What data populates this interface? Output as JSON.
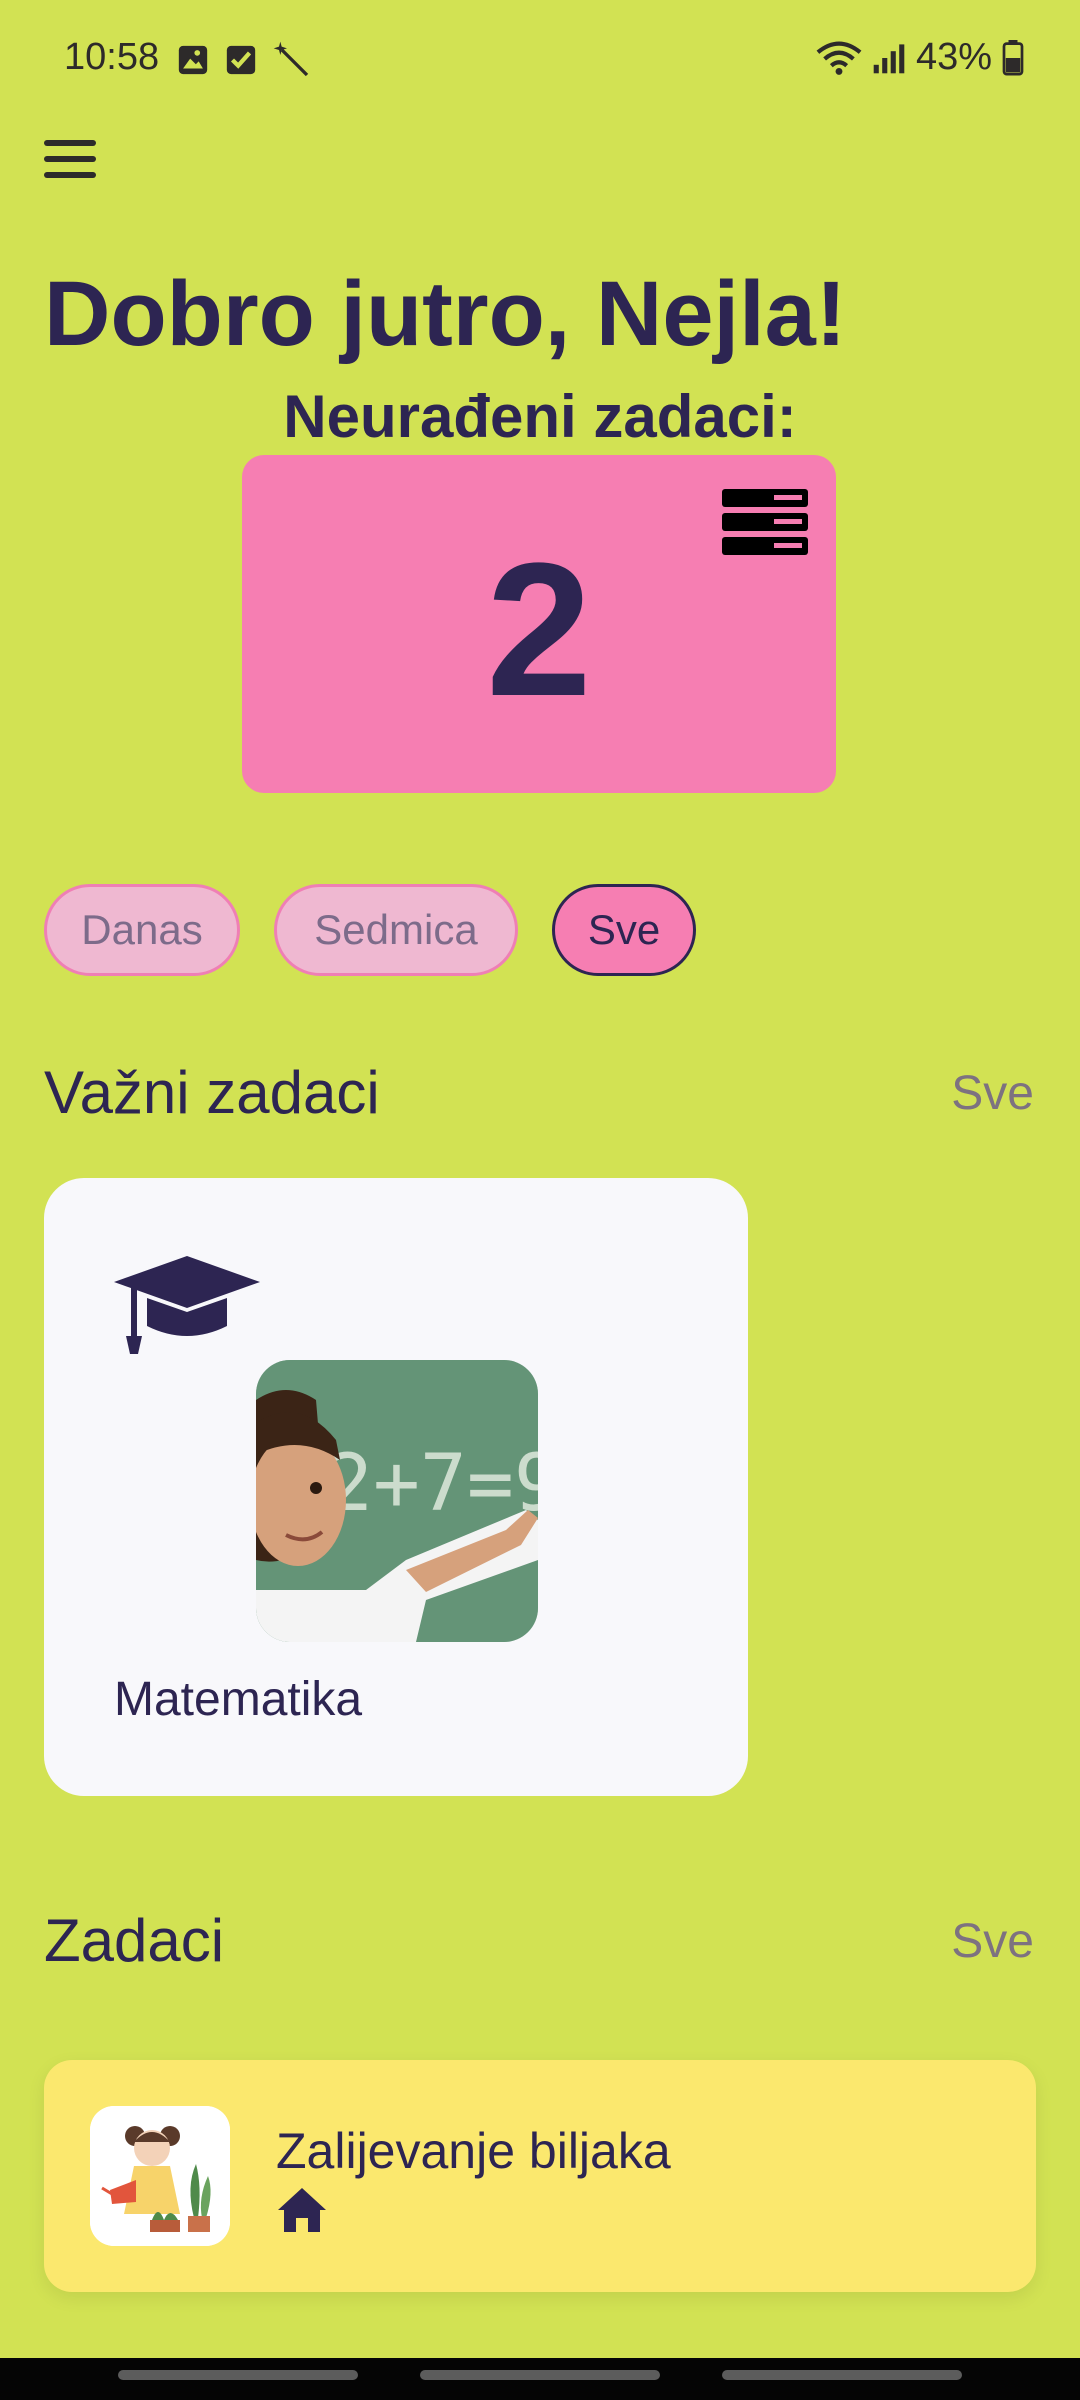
{
  "status_bar": {
    "time": "10:58",
    "battery": "43%"
  },
  "header": {
    "greeting": "Dobro jutro, Nejla!",
    "subtitle": "Neurađeni zadaci:"
  },
  "counter": {
    "value": "2"
  },
  "filters": [
    {
      "label": "Danas",
      "active": false
    },
    {
      "label": "Sedmica",
      "active": false
    },
    {
      "label": "Sve",
      "active": true
    }
  ],
  "important": {
    "title": "Važni zadaci",
    "see_all": "Sve",
    "cards": [
      {
        "label": "Matematika",
        "icon": "graduation-cap-icon"
      }
    ]
  },
  "tasks": {
    "title": "Zadaci",
    "see_all": "Sve",
    "items": [
      {
        "label": "Zalijevanje biljaka",
        "icon": "house-icon"
      }
    ]
  },
  "colors": {
    "background": "#d2e253",
    "accent_pink": "#f67eb2",
    "text_dark": "#2d2552",
    "task_card": "#fbe86e"
  }
}
